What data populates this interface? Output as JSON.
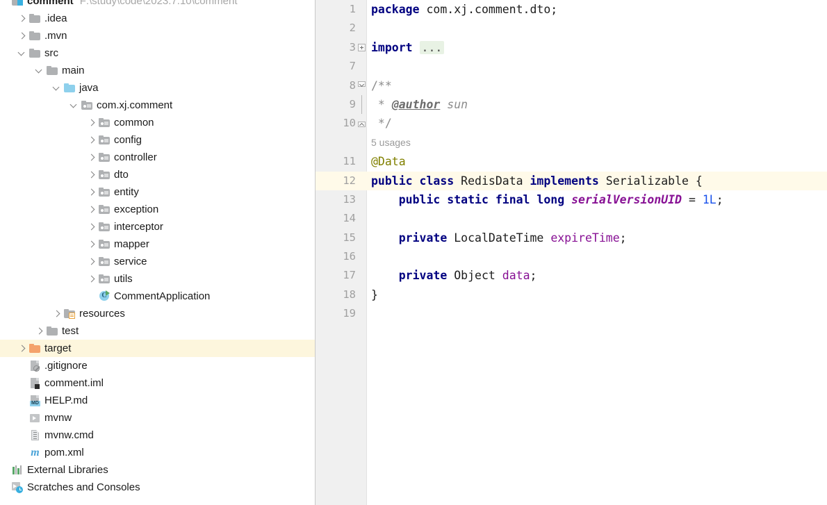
{
  "project": {
    "root": {
      "label": "comment",
      "path": "F:\\study\\code\\2023.7.10\\comment",
      "icon": "project-icon"
    },
    "items": [
      {
        "label": ".idea",
        "indent": 1,
        "twisty": "collapsed",
        "icon": "folder-icon",
        "selected": false
      },
      {
        "label": ".mvn",
        "indent": 1,
        "twisty": "collapsed",
        "icon": "folder-icon",
        "selected": false
      },
      {
        "label": "src",
        "indent": 1,
        "twisty": "expanded",
        "icon": "folder-icon",
        "selected": false
      },
      {
        "label": "main",
        "indent": 2,
        "twisty": "expanded",
        "icon": "folder-icon",
        "selected": false
      },
      {
        "label": "java",
        "indent": 3,
        "twisty": "expanded",
        "icon": "source-folder-icon",
        "selected": false
      },
      {
        "label": "com.xj.comment",
        "indent": 4,
        "twisty": "expanded",
        "icon": "package-icon",
        "selected": false
      },
      {
        "label": "common",
        "indent": 5,
        "twisty": "collapsed",
        "icon": "package-icon",
        "selected": false
      },
      {
        "label": "config",
        "indent": 5,
        "twisty": "collapsed",
        "icon": "package-icon",
        "selected": false
      },
      {
        "label": "controller",
        "indent": 5,
        "twisty": "collapsed",
        "icon": "package-icon",
        "selected": false
      },
      {
        "label": "dto",
        "indent": 5,
        "twisty": "collapsed",
        "icon": "package-icon",
        "selected": false
      },
      {
        "label": "entity",
        "indent": 5,
        "twisty": "collapsed",
        "icon": "package-icon",
        "selected": false
      },
      {
        "label": "exception",
        "indent": 5,
        "twisty": "collapsed",
        "icon": "package-icon",
        "selected": false
      },
      {
        "label": "interceptor",
        "indent": 5,
        "twisty": "collapsed",
        "icon": "package-icon",
        "selected": false
      },
      {
        "label": "mapper",
        "indent": 5,
        "twisty": "collapsed",
        "icon": "package-icon",
        "selected": false
      },
      {
        "label": "service",
        "indent": 5,
        "twisty": "collapsed",
        "icon": "package-icon",
        "selected": false
      },
      {
        "label": "utils",
        "indent": 5,
        "twisty": "collapsed",
        "icon": "package-icon",
        "selected": false
      },
      {
        "label": "CommentApplication",
        "indent": 5,
        "twisty": "none",
        "icon": "java-class-run-icon",
        "selected": false
      },
      {
        "label": "resources",
        "indent": 3,
        "twisty": "collapsed",
        "icon": "resources-folder-icon",
        "selected": false
      },
      {
        "label": "test",
        "indent": 2,
        "twisty": "collapsed",
        "icon": "folder-icon",
        "selected": false
      },
      {
        "label": "target",
        "indent": 1,
        "twisty": "collapsed",
        "icon": "excluded-folder-icon",
        "selected": true
      },
      {
        "label": ".gitignore",
        "indent": 1,
        "twisty": "none",
        "icon": "gitignore-file-icon",
        "selected": false
      },
      {
        "label": "comment.iml",
        "indent": 1,
        "twisty": "none",
        "icon": "iml-file-icon",
        "selected": false
      },
      {
        "label": "HELP.md",
        "indent": 1,
        "twisty": "none",
        "icon": "markdown-file-icon",
        "selected": false,
        "badge_text": "MD"
      },
      {
        "label": "mvnw",
        "indent": 1,
        "twisty": "none",
        "icon": "script-file-icon",
        "selected": false
      },
      {
        "label": "mvnw.cmd",
        "indent": 1,
        "twisty": "none",
        "icon": "cmd-file-icon",
        "selected": false
      },
      {
        "label": "pom.xml",
        "indent": 1,
        "twisty": "none",
        "icon": "maven-file-icon",
        "selected": false,
        "badge_text": "m"
      },
      {
        "label": "External Libraries",
        "indent": 0,
        "twisty": "none",
        "icon": "external-libraries-icon",
        "selected": false
      },
      {
        "label": "Scratches and Consoles",
        "indent": 0,
        "twisty": "none",
        "icon": "scratches-icon",
        "selected": false
      }
    ]
  },
  "editor": {
    "inlay_hint": "5 usages",
    "lines": [
      {
        "num": "1",
        "fold": "",
        "caret": false,
        "tokens": [
          {
            "t": "package",
            "c": "kw"
          },
          {
            "t": " com.xj.comment.dto;",
            "c": "cls"
          }
        ]
      },
      {
        "num": "2",
        "fold": "",
        "caret": false,
        "tokens": []
      },
      {
        "num": "3",
        "fold": "plus",
        "caret": false,
        "tokens": [
          {
            "t": "import",
            "c": "kw"
          },
          {
            "t": " ",
            "c": "cls"
          },
          {
            "t": "...",
            "c": "fold"
          }
        ]
      },
      {
        "num": "7",
        "fold": "",
        "caret": false,
        "tokens": []
      },
      {
        "num": "8",
        "fold": "top",
        "caret": false,
        "tokens": [
          {
            "t": "/**",
            "c": "cmtp"
          }
        ]
      },
      {
        "num": "9",
        "fold": "line",
        "caret": false,
        "tokens": [
          {
            "t": " * ",
            "c": "cmtp"
          },
          {
            "t": "@author",
            "c": "tag"
          },
          {
            "t": " ",
            "c": "cmtp"
          },
          {
            "t": "sun",
            "c": "cmt"
          }
        ]
      },
      {
        "num": "10",
        "fold": "bot",
        "caret": false,
        "tokens": [
          {
            "t": " */",
            "c": "cmtp"
          }
        ]
      },
      {
        "num": "",
        "fold": "",
        "caret": false,
        "inlay": "5 usages",
        "tokens": []
      },
      {
        "num": "11",
        "fold": "",
        "caret": false,
        "tokens": [
          {
            "t": "@Data",
            "c": "ann"
          }
        ]
      },
      {
        "num": "12",
        "fold": "",
        "caret": true,
        "tokens": [
          {
            "t": "public class",
            "c": "kw"
          },
          {
            "t": " RedisData ",
            "c": "cls"
          },
          {
            "t": "implements",
            "c": "kw"
          },
          {
            "t": " Serializable {",
            "c": "cls"
          }
        ]
      },
      {
        "num": "13",
        "fold": "",
        "caret": false,
        "tokens": [
          {
            "t": "    ",
            "c": "cls"
          },
          {
            "t": "public static final long",
            "c": "kw"
          },
          {
            "t": " ",
            "c": "cls"
          },
          {
            "t": "serialVersionUID",
            "c": "fldi"
          },
          {
            "t": " = ",
            "c": "cls"
          },
          {
            "t": "1L",
            "c": "num"
          },
          {
            "t": ";",
            "c": "cls"
          }
        ]
      },
      {
        "num": "14",
        "fold": "",
        "caret": false,
        "tokens": []
      },
      {
        "num": "15",
        "fold": "",
        "caret": false,
        "tokens": [
          {
            "t": "    ",
            "c": "cls"
          },
          {
            "t": "private",
            "c": "kw"
          },
          {
            "t": " LocalDateTime ",
            "c": "cls"
          },
          {
            "t": "expireTime",
            "c": "fld"
          },
          {
            "t": ";",
            "c": "cls"
          }
        ]
      },
      {
        "num": "16",
        "fold": "",
        "caret": false,
        "tokens": []
      },
      {
        "num": "17",
        "fold": "",
        "caret": false,
        "tokens": [
          {
            "t": "    ",
            "c": "cls"
          },
          {
            "t": "private",
            "c": "kw"
          },
          {
            "t": " Object ",
            "c": "cls"
          },
          {
            "t": "data",
            "c": "fld"
          },
          {
            "t": ";",
            "c": "cls"
          }
        ]
      },
      {
        "num": "18",
        "fold": "",
        "caret": false,
        "tokens": [
          {
            "t": "}",
            "c": "cls"
          }
        ]
      },
      {
        "num": "19",
        "fold": "",
        "caret": false,
        "tokens": []
      }
    ]
  },
  "colors": {
    "keyword": "#000080",
    "field": "#871094",
    "number": "#1750eb",
    "annotation": "#808000",
    "comment": "#8c8c8c",
    "selection": "#fdf6dd",
    "caret_line": "#fffae9",
    "fold_placeholder_bg": "#e8f2e4",
    "gutter_bg": "#f0f0f0"
  }
}
